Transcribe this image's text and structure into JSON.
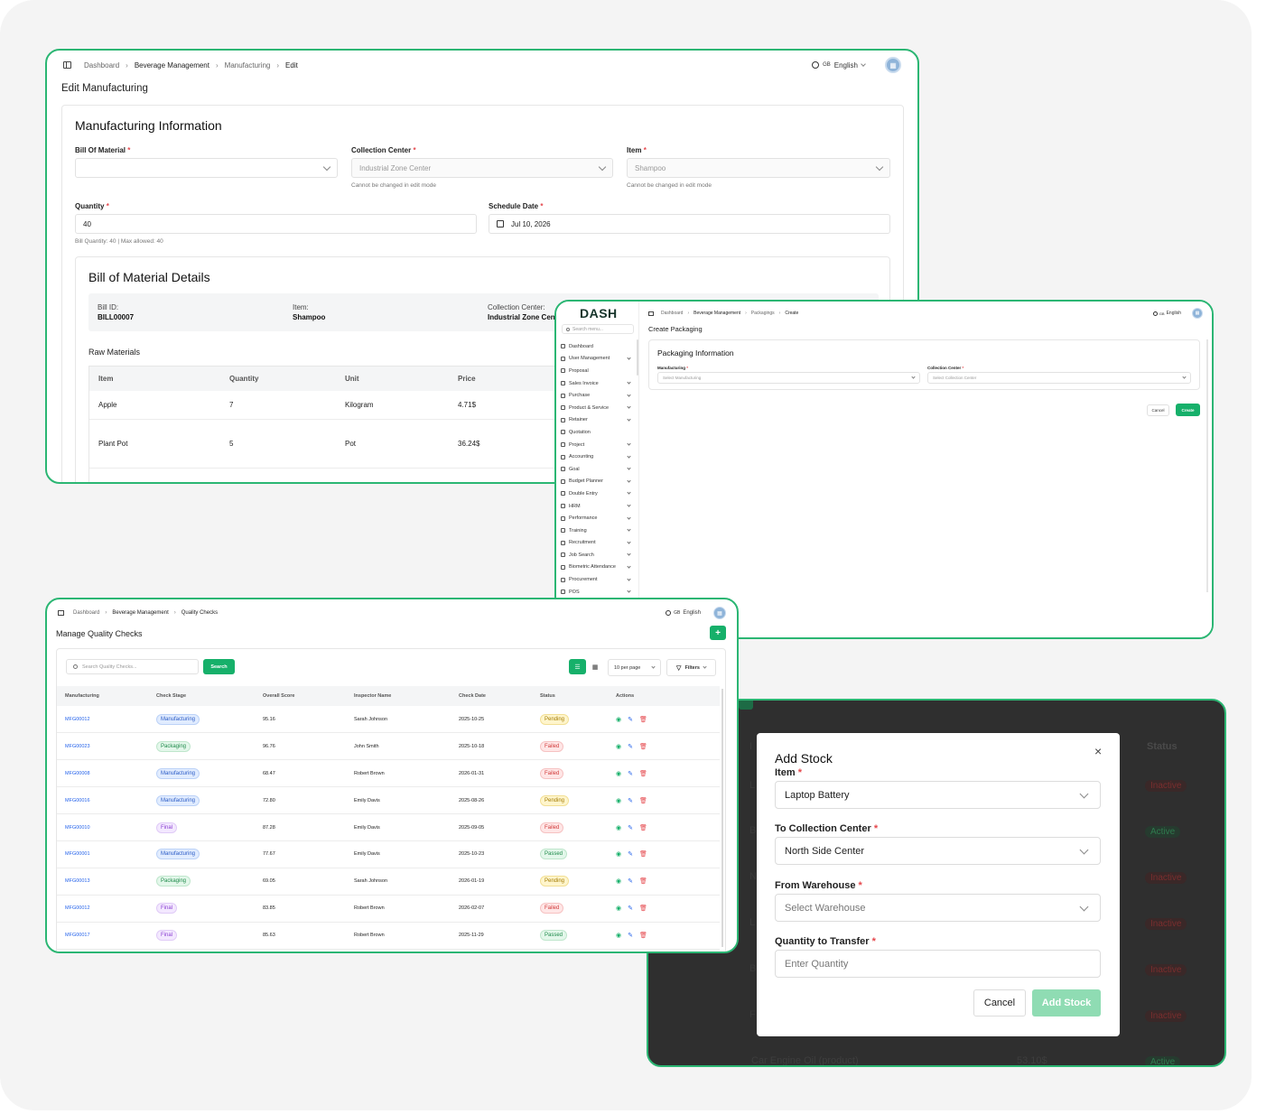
{
  "colors": {
    "accent": "#2bb673",
    "link": "#2563eb",
    "danger": "#e5484d"
  },
  "lang": {
    "code": "GB",
    "label": "English"
  },
  "edit_manufacturing": {
    "breadcrumb": [
      "Dashboard",
      "Beverage Management",
      "Manufacturing",
      "Edit"
    ],
    "page_title": "Edit Manufacturing",
    "section_title": "Manufacturing Information",
    "bom_label": "Bill Of Material",
    "bom_value": "",
    "collection_label": "Collection Center",
    "collection_value": "Industrial Zone Center",
    "collection_hint": "Cannot be changed in edit mode",
    "item_label": "Item",
    "item_value": "Shampoo",
    "item_hint": "Cannot be changed in edit mode",
    "qty_label": "Quantity",
    "qty_value": "40",
    "qty_hint": "Bill Quantity: 40 | Max allowed: 40",
    "date_label": "Schedule Date",
    "date_value": "Jul 10, 2026",
    "bom_details_title": "Bill of Material Details",
    "bill_id_label": "Bill ID:",
    "bill_id": "BILL00007",
    "bd_item_label": "Item:",
    "bd_item": "Shampoo",
    "bd_cc_label": "Collection Center:",
    "bd_cc": "Industrial Zone Center",
    "raw_title": "Raw Materials",
    "raw_headers": [
      "Item",
      "Quantity",
      "Unit",
      "Price"
    ],
    "raw_rows": [
      [
        "Apple",
        "7",
        "Kilogram",
        "4.71$"
      ],
      [
        "Plant Pot",
        "5",
        "Pot",
        "36.24$"
      ]
    ]
  },
  "create_packaging": {
    "logo": "DASH",
    "search_placeholder": "Search menu...",
    "menu": [
      "Dashboard",
      "User Management",
      "Proposal",
      "Sales Invoice",
      "Purchase",
      "Product & Service",
      "Retainer",
      "Quotation",
      "Project",
      "Accounting",
      "Goal",
      "Budget Planner",
      "Double Entry",
      "HRM",
      "Performance",
      "Training",
      "Recruitment",
      "Job Search",
      "Biometric Attendance",
      "Procurement",
      "POS"
    ],
    "breadcrumb": [
      "Dashboard",
      "Beverage Management",
      "Packagings",
      "Create"
    ],
    "page_title": "Create Packaging",
    "section_title": "Packaging Information",
    "mfg_label": "Manufacturing",
    "mfg_placeholder": "Select Manufacturing",
    "cc_label": "Collection Center",
    "cc_placeholder": "Select Collection Center",
    "cancel": "Cancel",
    "create": "Create"
  },
  "quality_checks": {
    "breadcrumb": [
      "Dashboard",
      "Beverage Management",
      "Quality Checks"
    ],
    "page_title": "Manage Quality Checks",
    "add_label": "+",
    "search_placeholder": "Search Quality Checks...",
    "search_btn": "Search",
    "per_page": "10 per page",
    "filters": "Filters",
    "headers": [
      "Manufacturing",
      "Check Stage",
      "Overall Score",
      "Inspector Name",
      "Check Date",
      "Status",
      "Actions"
    ],
    "rows": [
      {
        "mfg": "MFG00012",
        "stage": "Manufacturing",
        "score": "95.16",
        "inspector": "Sarah Johnson",
        "date": "2025-10-25",
        "status": "Pending"
      },
      {
        "mfg": "MFG00023",
        "stage": "Packaging",
        "score": "96.76",
        "inspector": "John Smith",
        "date": "2025-10-18",
        "status": "Failed"
      },
      {
        "mfg": "MFG00008",
        "stage": "Manufacturing",
        "score": "68.47",
        "inspector": "Robert Brown",
        "date": "2026-01-31",
        "status": "Failed"
      },
      {
        "mfg": "MFG00016",
        "stage": "Manufacturing",
        "score": "72.80",
        "inspector": "Emily Davis",
        "date": "2025-08-26",
        "status": "Pending"
      },
      {
        "mfg": "MFG00010",
        "stage": "Final",
        "score": "87.28",
        "inspector": "Emily Davis",
        "date": "2025-09-05",
        "status": "Failed"
      },
      {
        "mfg": "MFG00001",
        "stage": "Manufacturing",
        "score": "77.67",
        "inspector": "Emily Davis",
        "date": "2025-10-23",
        "status": "Passed"
      },
      {
        "mfg": "MFG00013",
        "stage": "Packaging",
        "score": "69.05",
        "inspector": "Sarah Johnson",
        "date": "2026-01-19",
        "status": "Pending"
      },
      {
        "mfg": "MFG00012",
        "stage": "Final",
        "score": "83.85",
        "inspector": "Robert Brown",
        "date": "2026-02-07",
        "status": "Failed"
      },
      {
        "mfg": "MFG00017",
        "stage": "Final",
        "score": "85.63",
        "inspector": "Robert Brown",
        "date": "2025-11-29",
        "status": "Passed"
      }
    ]
  },
  "add_stock": {
    "bg_status_header": "Status",
    "bg_statuses": [
      "Inactive",
      "Active",
      "Inactive",
      "Inactive",
      "Inactive",
      "Inactive",
      "Active"
    ],
    "bg_last_row_name": "Car Engine Oil (product)",
    "bg_last_row_price": "53.10$",
    "title": "Add Stock",
    "item_label": "Item",
    "item_value": "Laptop Battery",
    "to_cc_label": "To Collection Center",
    "to_cc_value": "North Side Center",
    "wh_label": "From Warehouse",
    "wh_placeholder": "Select Warehouse",
    "qty_label": "Quantity to Transfer",
    "qty_placeholder": "Enter Quantity",
    "cancel": "Cancel",
    "submit": "Add Stock"
  }
}
